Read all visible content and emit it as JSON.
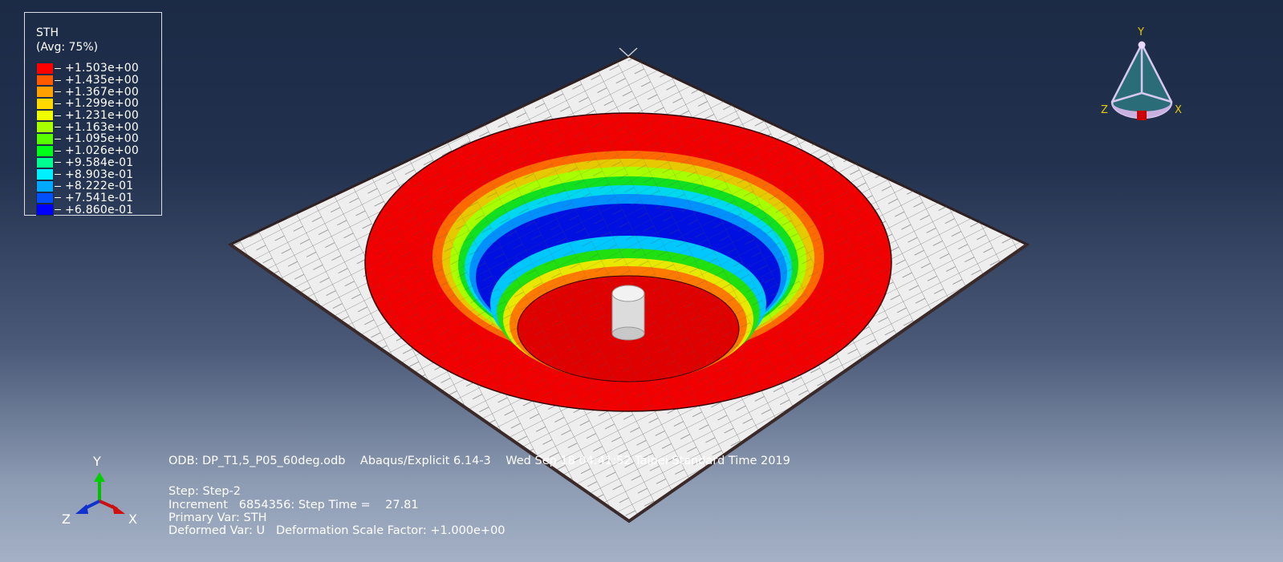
{
  "legend": {
    "title": "STH",
    "subtitle": "(Avg: 75%)",
    "entries": [
      {
        "value": "+1.503e+00",
        "color": "#ff0000"
      },
      {
        "value": "+1.435e+00",
        "color": "#ff5a00"
      },
      {
        "value": "+1.367e+00",
        "color": "#ffa000"
      },
      {
        "value": "+1.299e+00",
        "color": "#ffd800"
      },
      {
        "value": "+1.231e+00",
        "color": "#f0ff00"
      },
      {
        "value": "+1.163e+00",
        "color": "#a8ff00"
      },
      {
        "value": "+1.095e+00",
        "color": "#58ff00"
      },
      {
        "value": "+1.026e+00",
        "color": "#00ff18"
      },
      {
        "value": "+9.584e-01",
        "color": "#00ff90"
      },
      {
        "value": "+8.903e-01",
        "color": "#00f0ff"
      },
      {
        "value": "+8.222e-01",
        "color": "#00a8ff"
      },
      {
        "value": "+7.541e-01",
        "color": "#0050ff"
      },
      {
        "value": "+6.860e-01",
        "color": "#0000ff"
      }
    ]
  },
  "info": {
    "odb_line": "ODB: DP_T1,5_P05_60deg.odb    Abaqus/Explicit 6.14-3    Wed Sep 18 04:41:52 Taipei Standard Time 2019",
    "step": "Step: Step-2",
    "increment": "Increment   6854356: Step Time =    27.81",
    "primary_var": "Primary Var: STH",
    "deformed_var": "Deformed Var: U   Deformation Scale Factor: +1.000e+00"
  },
  "triad": {
    "y": "Y",
    "z": "Z",
    "x": "X"
  },
  "view_cube": {
    "y": "Y",
    "z": "Z",
    "x": "X"
  },
  "colors": {
    "sheet": "#eeeeee",
    "mesh_line": "#333333",
    "contour_max": "#ff0000",
    "contour_min": "#0000ff",
    "rim_gold": "#e6c900",
    "y_axis": "#00c000",
    "x_axis": "#cc1010",
    "z_axis": "#1030d0"
  }
}
